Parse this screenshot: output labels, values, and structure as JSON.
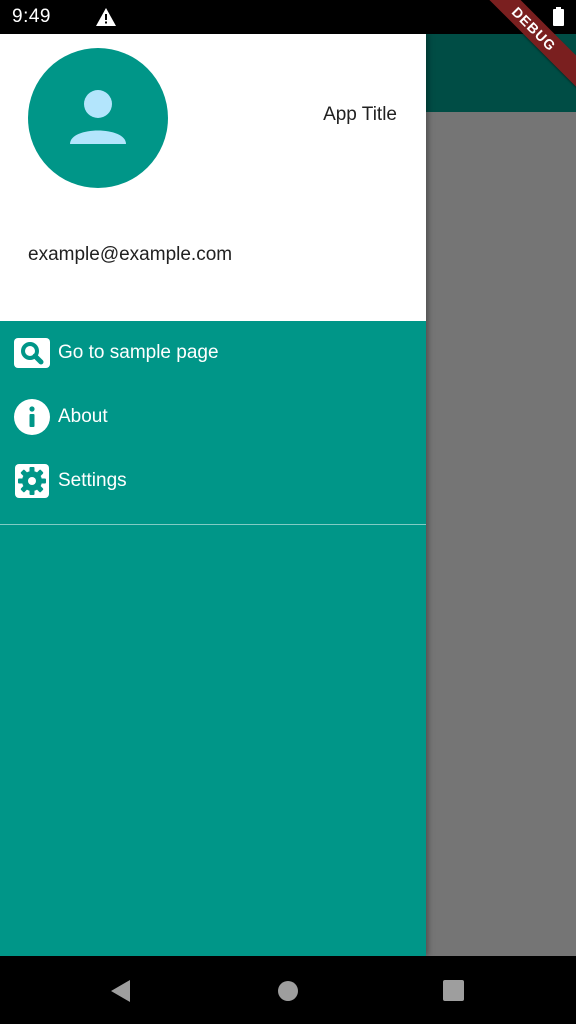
{
  "status_bar": {
    "time": "9:49",
    "alert_icon": "warning-icon",
    "battery_icon": "battery-icon"
  },
  "debug_banner": "DEBUG",
  "drawer": {
    "header": {
      "avatar_icon": "person-icon",
      "app_title": "App Title",
      "email": "example@example.com"
    },
    "items": [
      {
        "label": "Go to sample page",
        "icon": "search-icon"
      },
      {
        "label": "About",
        "icon": "info-icon"
      },
      {
        "label": "Settings",
        "icon": "settings-icon"
      }
    ]
  },
  "colors": {
    "primary": "#009688",
    "app_bar": "#004d45",
    "scrim": "#757575",
    "avatar_figure": "#b3e5fc"
  },
  "nav_bar": {
    "back_icon": "back-icon",
    "home_icon": "home-icon",
    "recents_icon": "recents-icon"
  }
}
